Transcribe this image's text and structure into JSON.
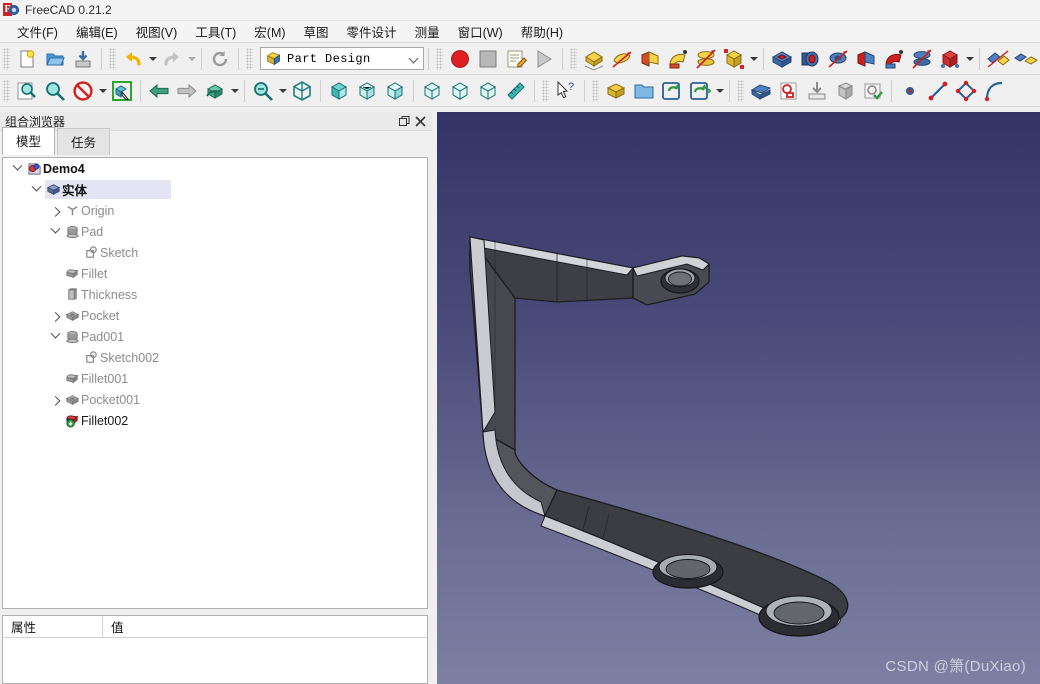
{
  "window": {
    "title": "FreeCAD 0.21.2",
    "app_icon": "freecad-logo-icon"
  },
  "menubar": {
    "items": [
      {
        "label": "文件(F)",
        "name": "menu-file"
      },
      {
        "label": "编辑(E)",
        "name": "menu-edit"
      },
      {
        "label": "视图(V)",
        "name": "menu-view"
      },
      {
        "label": "工具(T)",
        "name": "menu-tools"
      },
      {
        "label": "宏(M)",
        "name": "menu-macro"
      },
      {
        "label": "草图",
        "name": "menu-sketch"
      },
      {
        "label": "零件设计",
        "name": "menu-part-design"
      },
      {
        "label": "测量",
        "name": "menu-measure"
      },
      {
        "label": "窗口(W)",
        "name": "menu-window"
      },
      {
        "label": "帮助(H)",
        "name": "menu-help"
      }
    ]
  },
  "toolbar_main": {
    "workbench_selector": {
      "value": "Part Design",
      "icon": "part-design-workbench-icon"
    },
    "file_group": [
      "new-document-icon",
      "open-document-icon",
      "save-document-icon"
    ],
    "edit_group": [
      "undo-icon",
      "redo-icon",
      "refresh-icon"
    ],
    "macro_group": [
      "macro-record-icon",
      "macro-stop-icon",
      "macro-edit-icon",
      "macro-execute-icon"
    ],
    "additive_group": [
      "pad-icon",
      "revolution-icon",
      "additive-loft-icon",
      "additive-pipe-icon",
      "additive-helix-icon",
      "additive-primitive-icon"
    ],
    "subtractive_group": [
      "pocket-icon",
      "groove-icon",
      "subtractive-loft-icon",
      "subtractive-pipe-icon",
      "subtractive-helix-icon",
      "subtractive-primitive-icon"
    ],
    "transform_group": [
      "mirrored-icon",
      "linear-pattern-icon"
    ]
  },
  "toolbar_view": {
    "view_group": [
      "fit-all-icon",
      "fit-selection-icon",
      "draw-style-icon",
      "selection-view-icon"
    ],
    "nav_group": [
      "back-icon",
      "forward-icon",
      "box-selection-icon"
    ],
    "zoom_group": [
      "zoom-box-icon",
      "axonometric-icon"
    ],
    "std_views": [
      "front-view-icon",
      "top-view-icon",
      "right-view-icon",
      "rear-view-icon",
      "bottom-view-icon",
      "left-view-icon"
    ],
    "measure_group": [
      "measure-icon"
    ],
    "help_group": [
      "whats-this-icon"
    ],
    "structure_group": [
      "create-body-icon",
      "create-group-icon",
      "create-part-icon",
      "make-link-icon"
    ],
    "sketch_group": [
      "create-sketch-icon",
      "edit-sketch-icon",
      "attach-sketch-icon",
      "map-sketch-icon",
      "validate-sketch-icon"
    ],
    "geometry_group": [
      "point-icon",
      "line-icon",
      "polyline-icon",
      "arc-icon"
    ]
  },
  "dock": {
    "title": "组合浏览器",
    "float_icon": "restore-icon",
    "close_icon": "close-icon",
    "tabs": [
      {
        "label": "模型",
        "name": "tab-model",
        "active": true
      },
      {
        "label": "任务",
        "name": "tab-tasks",
        "active": false
      }
    ]
  },
  "tree": {
    "items": [
      {
        "label": "Demo4",
        "icon": "document-icon",
        "depth": 0,
        "twist": "open",
        "style": "bold",
        "selected": false
      },
      {
        "label": "实体",
        "icon": "body-icon",
        "depth": 1,
        "twist": "open",
        "style": "bold",
        "selected": true
      },
      {
        "label": "Origin",
        "icon": "origin-icon",
        "depth": 2,
        "twist": "closed",
        "style": "inactive",
        "selected": false
      },
      {
        "label": "Pad",
        "icon": "pad-icon",
        "depth": 2,
        "twist": "open",
        "style": "inactive",
        "selected": false
      },
      {
        "label": "Sketch",
        "icon": "sketch-icon",
        "depth": 3,
        "twist": "none",
        "style": "inactive",
        "selected": false
      },
      {
        "label": "Fillet",
        "icon": "fillet-icon",
        "depth": 2,
        "twist": "none",
        "style": "inactive",
        "selected": false
      },
      {
        "label": "Thickness",
        "icon": "thickness-icon",
        "depth": 2,
        "twist": "none",
        "style": "inactive",
        "selected": false
      },
      {
        "label": "Pocket",
        "icon": "pocket-icon",
        "depth": 2,
        "twist": "closed",
        "style": "inactive",
        "selected": false
      },
      {
        "label": "Pad001",
        "icon": "pad-icon",
        "depth": 2,
        "twist": "open",
        "style": "inactive",
        "selected": false
      },
      {
        "label": "Sketch002",
        "icon": "sketch-icon",
        "depth": 3,
        "twist": "none",
        "style": "inactive",
        "selected": false
      },
      {
        "label": "Fillet001",
        "icon": "fillet-icon",
        "depth": 2,
        "twist": "none",
        "style": "inactive",
        "selected": false
      },
      {
        "label": "Pocket001",
        "icon": "pocket-icon",
        "depth": 2,
        "twist": "closed",
        "style": "inactive",
        "selected": false
      },
      {
        "label": "Fillet002",
        "icon": "tip-fillet-icon",
        "depth": 2,
        "twist": "none",
        "style": "active",
        "selected": false
      }
    ]
  },
  "properties": {
    "columns": [
      "属性",
      "值"
    ],
    "rows": []
  },
  "viewport": {
    "watermark": "CSDN @箫(DuXiao)",
    "background_top": "#333366",
    "background_bottom": "#7d80a3",
    "model_name": "sheet-metal-bracket",
    "model_face_color": "#3b3d42",
    "model_edge_color": "#d5d7da"
  }
}
